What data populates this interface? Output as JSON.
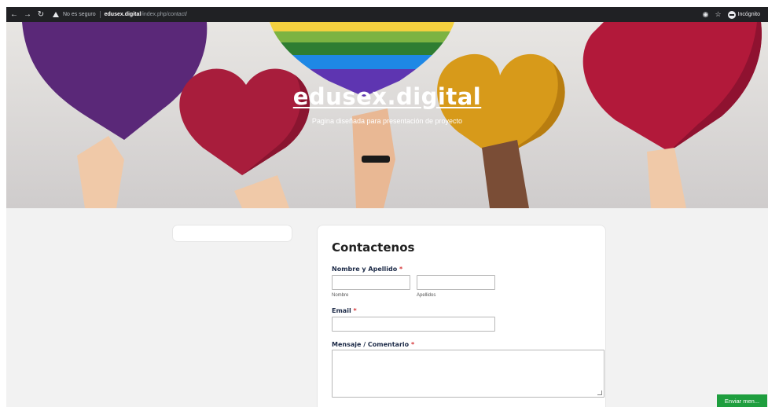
{
  "browser": {
    "not_secure": "No es seguro",
    "url_host": "edusex.digital",
    "url_path": "/index.php/contact/",
    "profile_label": "Incógnito"
  },
  "hero": {
    "title": "edusex.digital",
    "subtitle": "Pagina diseñada para presentación de proyecto"
  },
  "form": {
    "title": "Contactenos",
    "name_label": "Nombre y Apellido",
    "required_mark": "*",
    "first_name_hint": "Nombre",
    "last_name_hint": "Apellidos",
    "email_label": "Email",
    "message_label": "Mensaje / Comentario",
    "first_name_value": "",
    "last_name_value": "",
    "email_value": "",
    "message_value": ""
  },
  "floating_button": {
    "label": "Enviar men..."
  },
  "colors": {
    "chrome_bg": "#202124",
    "content_bg": "#f2f2f2",
    "accent_green": "#1e9e3e",
    "required_red": "#d63638",
    "label_navy": "#1c2a47"
  }
}
